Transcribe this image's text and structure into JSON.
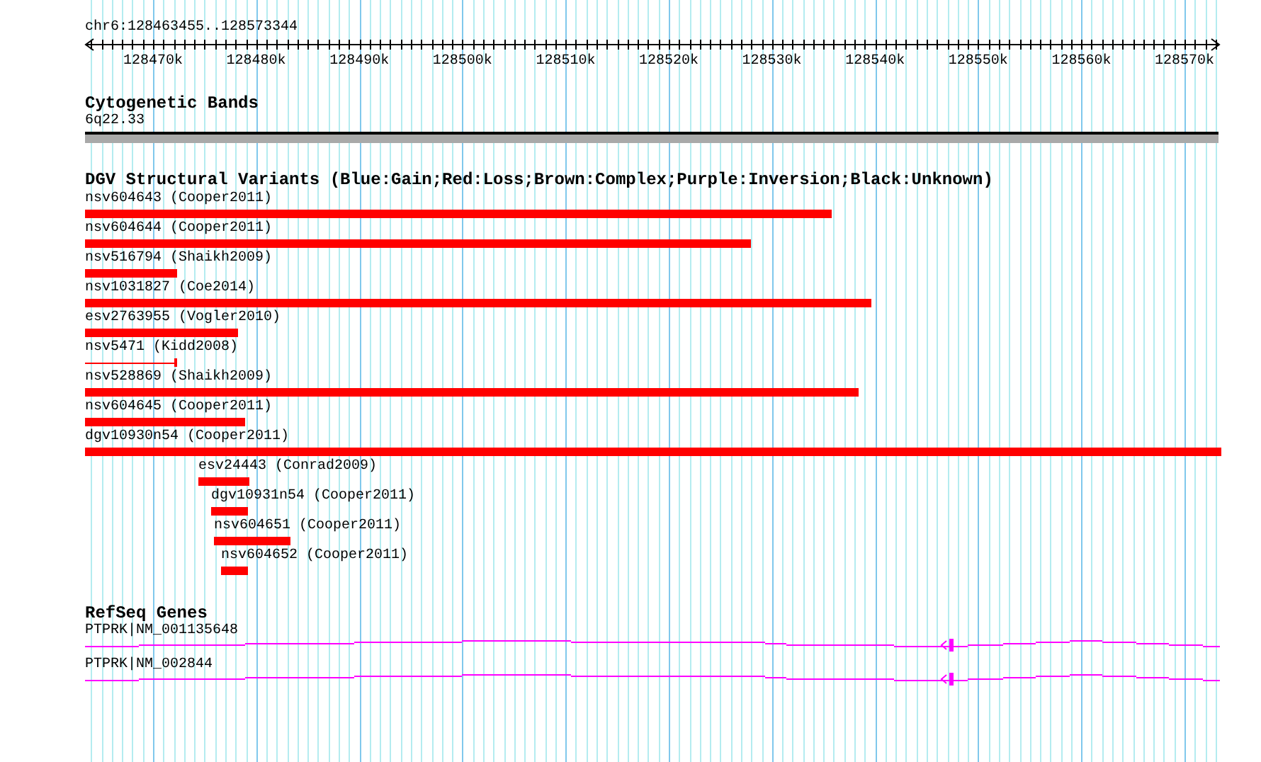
{
  "ruler": {
    "location": "chr6:128463455..128573344",
    "ticks": [
      "128470k",
      "128480k",
      "128490k",
      "128500k",
      "128510k",
      "128520k",
      "128530k",
      "128540k",
      "128550k",
      "128560k",
      "128570k"
    ]
  },
  "tracks": [
    {
      "kind": "bands",
      "title": "Cytogenetic Bands",
      "features": [
        {
          "label": "6q22.33"
        }
      ]
    },
    {
      "kind": "variants",
      "title": "DGV Structural Variants (Blue:Gain;Red:Loss;Brown:Complex;Purple:Inversion;Black:Unknown)",
      "features": [
        {
          "label": "nsv604643 (Cooper2011)",
          "color": "#ff0000"
        },
        {
          "label": "nsv604644 (Cooper2011)",
          "color": "#ff0000"
        },
        {
          "label": "nsv516794 (Shaikh2009)",
          "color": "#ff0000"
        },
        {
          "label": "nsv1031827 (Coe2014)",
          "color": "#ff0000"
        },
        {
          "label": "esv2763955 (Vogler2010)",
          "color": "#ff0000"
        },
        {
          "label": "nsv5471 (Kidd2008)",
          "color": "#ff0000"
        },
        {
          "label": "nsv528869 (Shaikh2009)",
          "color": "#ff0000"
        },
        {
          "label": "nsv604645 (Cooper2011)",
          "color": "#ff0000"
        },
        {
          "label": "dgv10930n54 (Cooper2011)",
          "color": "#ff0000"
        },
        {
          "label": "esv24443 (Conrad2009)",
          "color": "#ff0000"
        },
        {
          "label": "dgv10931n54 (Cooper2011)",
          "color": "#ff0000"
        },
        {
          "label": "nsv604651 (Cooper2011)",
          "color": "#ff0000"
        },
        {
          "label": "nsv604652 (Cooper2011)",
          "color": "#ff0000"
        }
      ]
    },
    {
      "kind": "genes",
      "title": "RefSeq Genes",
      "features": [
        {
          "label": "PTPRK|NM_001135648"
        },
        {
          "label": "PTPRK|NM_002844"
        }
      ]
    }
  ]
}
